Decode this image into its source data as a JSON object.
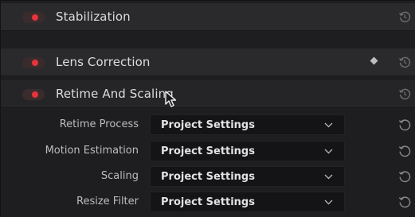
{
  "sections": [
    {
      "title": "Stabilization",
      "enabled": true,
      "has_keyframe": false
    },
    {
      "title": "Lens Correction",
      "enabled": true,
      "has_keyframe": true
    },
    {
      "title": "Retime And Scaling",
      "enabled": true,
      "has_keyframe": false
    }
  ],
  "properties": [
    {
      "label": "Retime Process",
      "value": "Project Settings"
    },
    {
      "label": "Motion Estimation",
      "value": "Project Settings"
    },
    {
      "label": "Scaling",
      "value": "Project Settings"
    },
    {
      "label": "Resize Filter",
      "value": "Project Settings"
    }
  ],
  "colors": {
    "toggle_on": "#e5343b",
    "panel_bg": "#1e1e21",
    "header_bg": "#2a2a2d",
    "dropdown_bg": "#141416"
  },
  "icons": {
    "reset": "reset-icon",
    "keyframe": "keyframe-diamond-icon",
    "dropdown": "chevron-down-icon",
    "cursor": "mouse-cursor-icon"
  }
}
